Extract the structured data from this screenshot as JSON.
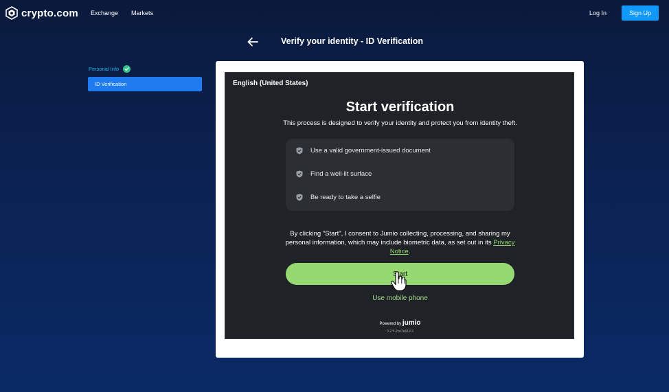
{
  "header": {
    "logo_text": "crypto.com",
    "nav": {
      "exchange": "Exchange",
      "markets": "Markets"
    },
    "login": "Log In",
    "signup": "Sign Up"
  },
  "title_bar": {
    "back_icon": "arrow-left-icon",
    "title": "Verify your identity - ID Verification"
  },
  "sidebar": {
    "steps": [
      {
        "label": "Personal Info",
        "status": "complete"
      },
      {
        "label": "ID Verification",
        "status": "active"
      }
    ]
  },
  "jumio": {
    "language": "English (United States)",
    "heading": "Start verification",
    "subheading": "This process is designed to verify your identity and protect you from identity theft.",
    "checklist": [
      "Use a valid government-issued document",
      "Find a well-lit surface",
      "Be ready to take a selfie"
    ],
    "consent_prefix": "By clicking \"Start\", I consent to Jumio collecting, processing, and sharing my personal information, which may include biometric data, as set out in its ",
    "privacy_link": "Privacy Notice",
    "consent_suffix": ".",
    "start_button": "Start",
    "mobile_link": "Use mobile phone",
    "powered_prefix": "Powered by",
    "powered_brand": "jumio",
    "version": "0.2.5-2ce7e619.3"
  },
  "colors": {
    "signup_bg": "#1199fa",
    "active_step_bg": "#1e7cf0",
    "start_bg": "#96d872",
    "check_badge": "#34c38f"
  }
}
